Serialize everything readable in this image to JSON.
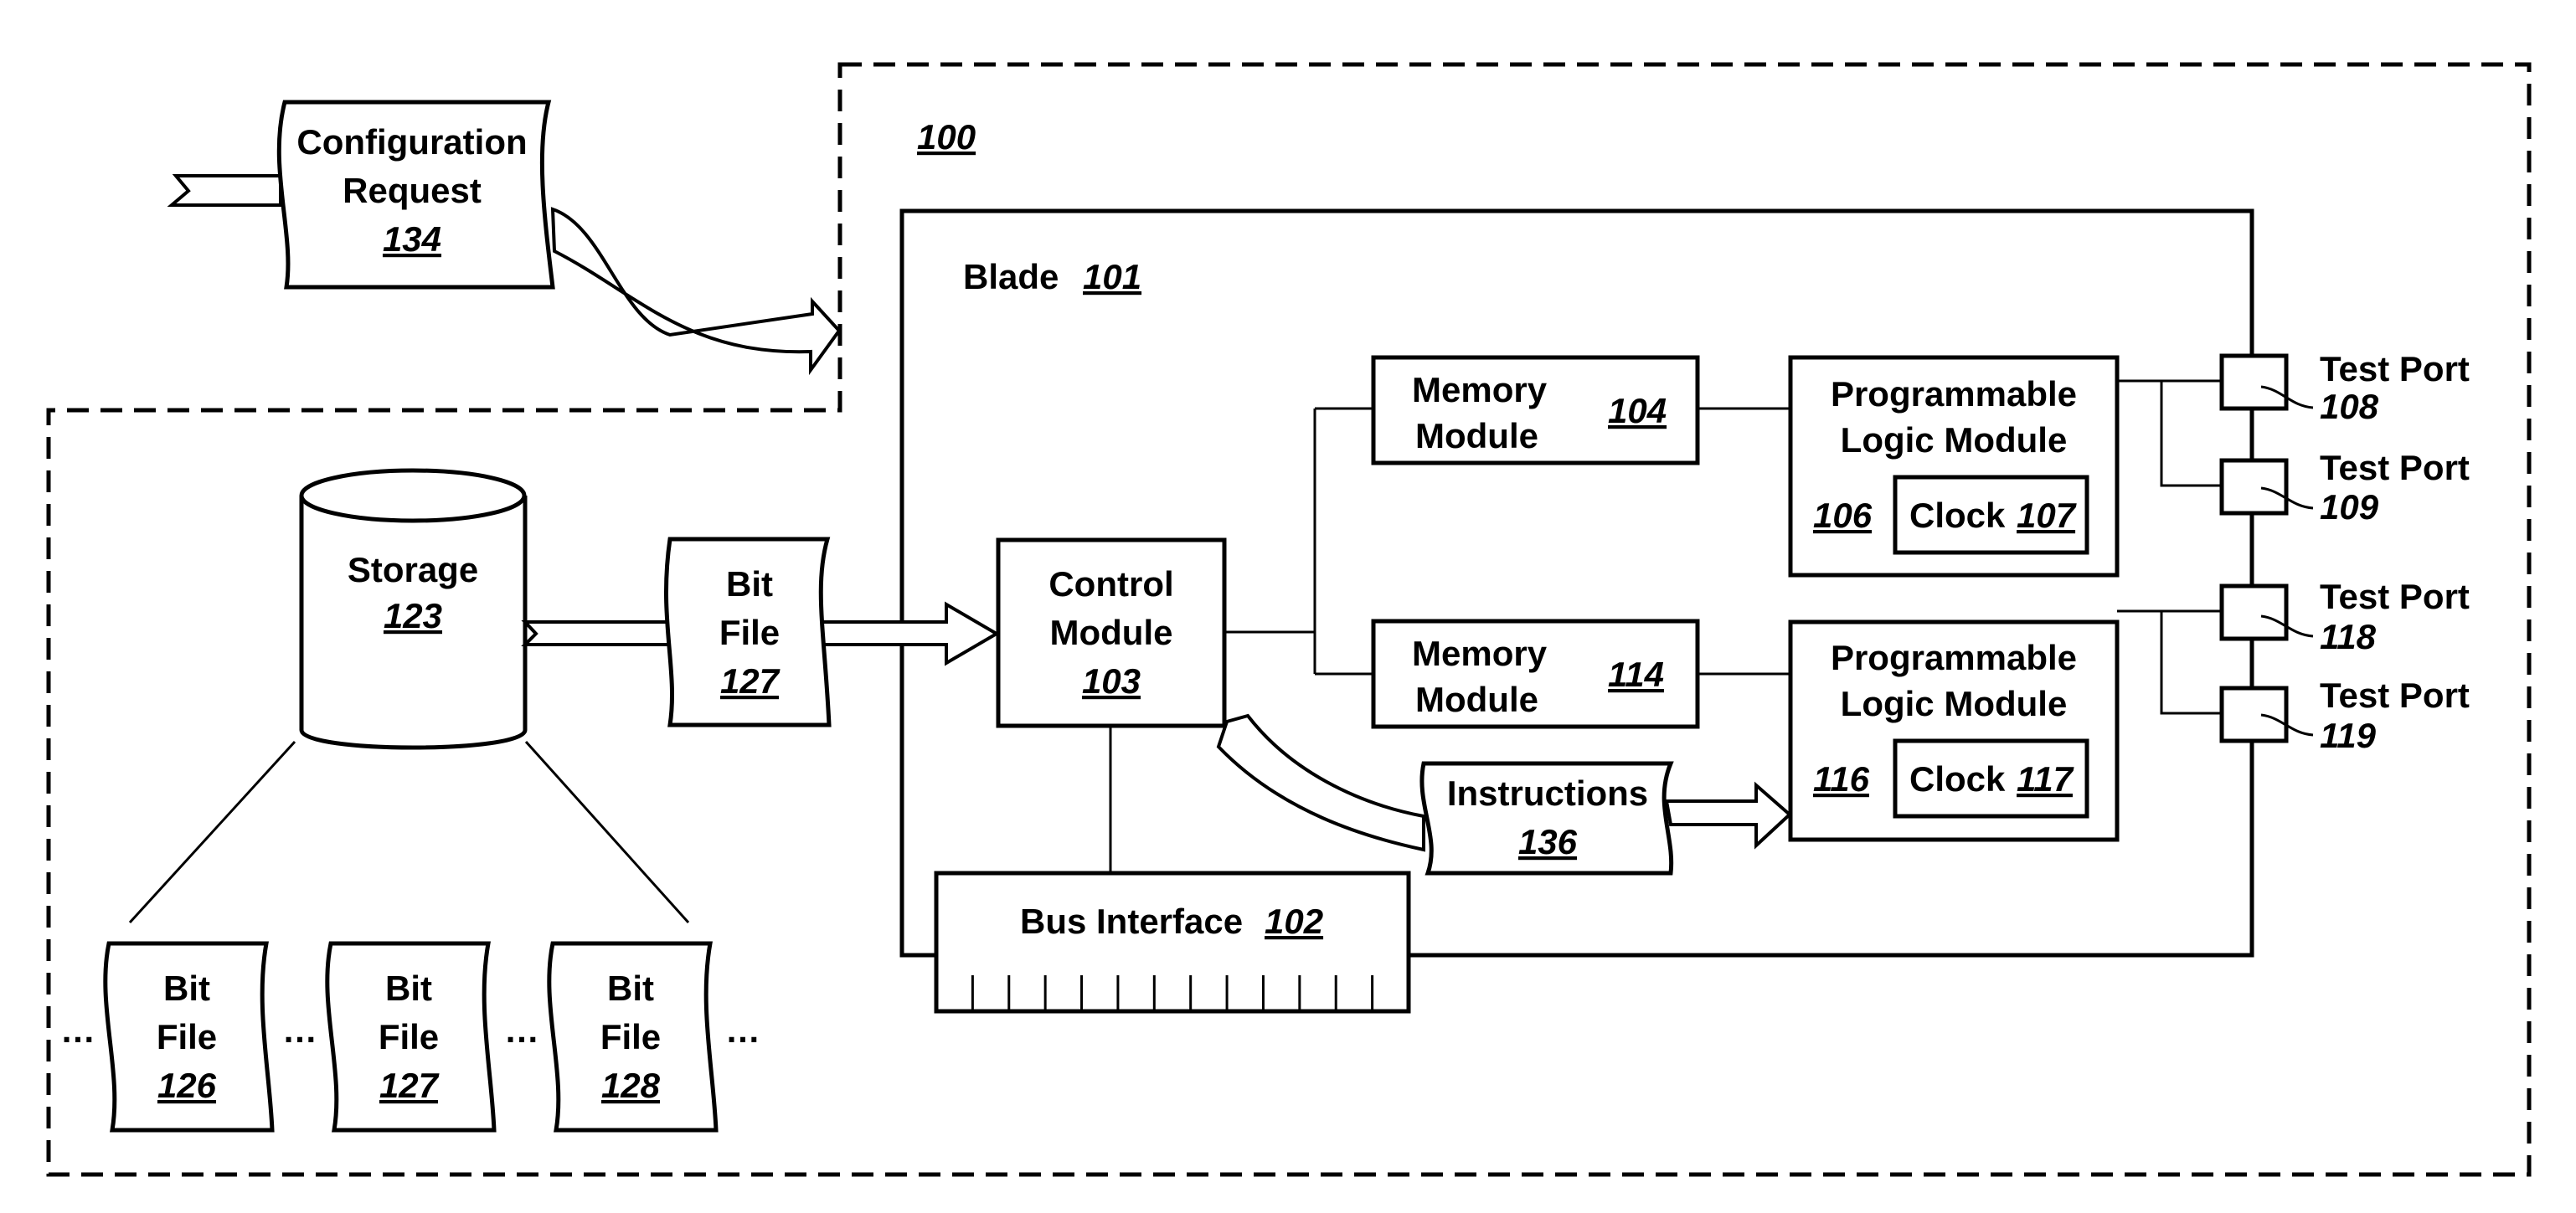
{
  "diagram": {
    "system": {
      "ref": "100"
    },
    "blade": {
      "label": "Blade",
      "ref": "101"
    },
    "bus_interface": {
      "label": "Bus Interface",
      "ref": "102",
      "pin_count": 12
    },
    "control_module": {
      "line1": "Control",
      "line2": "Module",
      "ref": "103"
    },
    "memory_modules": [
      {
        "line1": "Memory",
        "line2": "Module",
        "ref": "104"
      },
      {
        "line1": "Memory",
        "line2": "Module",
        "ref": "114"
      }
    ],
    "logic_modules": [
      {
        "line1": "Programmable",
        "line2": "Logic Module",
        "ref": "106",
        "clock_label": "Clock",
        "clock_ref": "107"
      },
      {
        "line1": "Programmable",
        "line2": "Logic Module",
        "ref": "116",
        "clock_label": "Clock",
        "clock_ref": "117"
      }
    ],
    "test_ports": [
      {
        "label": "Test Port",
        "ref": "108"
      },
      {
        "label": "Test Port",
        "ref": "109"
      },
      {
        "label": "Test Port",
        "ref": "118"
      },
      {
        "label": "Test Port",
        "ref": "119"
      }
    ],
    "configuration_request": {
      "line1": "Configuration",
      "line2": "Request",
      "ref": "134"
    },
    "storage": {
      "label": "Storage",
      "ref": "123"
    },
    "bit_file_transfer": {
      "line1": "Bit",
      "line2": "File",
      "ref": "127"
    },
    "instructions": {
      "label": "Instructions",
      "ref": "136"
    },
    "stored_bit_files": [
      {
        "line1": "Bit",
        "line2": "File",
        "ref": "126"
      },
      {
        "line1": "Bit",
        "line2": "File",
        "ref": "127"
      },
      {
        "line1": "Bit",
        "line2": "File",
        "ref": "128"
      }
    ],
    "ellipsis": "…"
  }
}
